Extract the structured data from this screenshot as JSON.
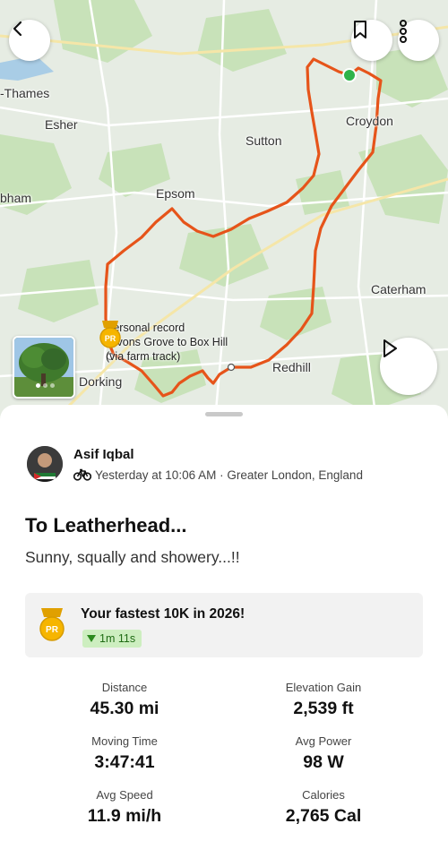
{
  "map": {
    "places": {
      "thames": "-Thames",
      "esher": "Esher",
      "sutton": "Sutton",
      "croydon": "Croydon",
      "bham": "bham",
      "epsom": "Epsom",
      "caterham": "Caterham",
      "redhill": "Redhill",
      "dorking": "Dorking"
    },
    "pr_callout": {
      "line1": "Personal record",
      "line2": "Givons Grove to Box Hill",
      "line3": "(via farm track)"
    },
    "pr_badge": "PR",
    "route_color": "#e6541a",
    "start_color": "#2fb34a"
  },
  "activity": {
    "athlete_name": "Asif Iqbal",
    "meta": "Yesterday at 10:06 AM · Greater London, England",
    "sport_icon": "bicycle-icon",
    "title": "To Leatherhead...",
    "description": "Sunny, squally and showery...!!"
  },
  "achievement": {
    "text": "Your fastest 10K in 2026!",
    "delta": "1m 11s",
    "badge": "PR"
  },
  "stats": {
    "distance_label": "Distance",
    "distance": "45.30 mi",
    "elevation_label": "Elevation Gain",
    "elevation": "2,539 ft",
    "moving_label": "Moving Time",
    "moving": "3:47:41",
    "power_label": "Avg Power",
    "power": "98 W",
    "speed_label": "Avg Speed",
    "speed": "11.9 mi/h",
    "calories_label": "Calories",
    "calories": "2,765 Cal"
  }
}
